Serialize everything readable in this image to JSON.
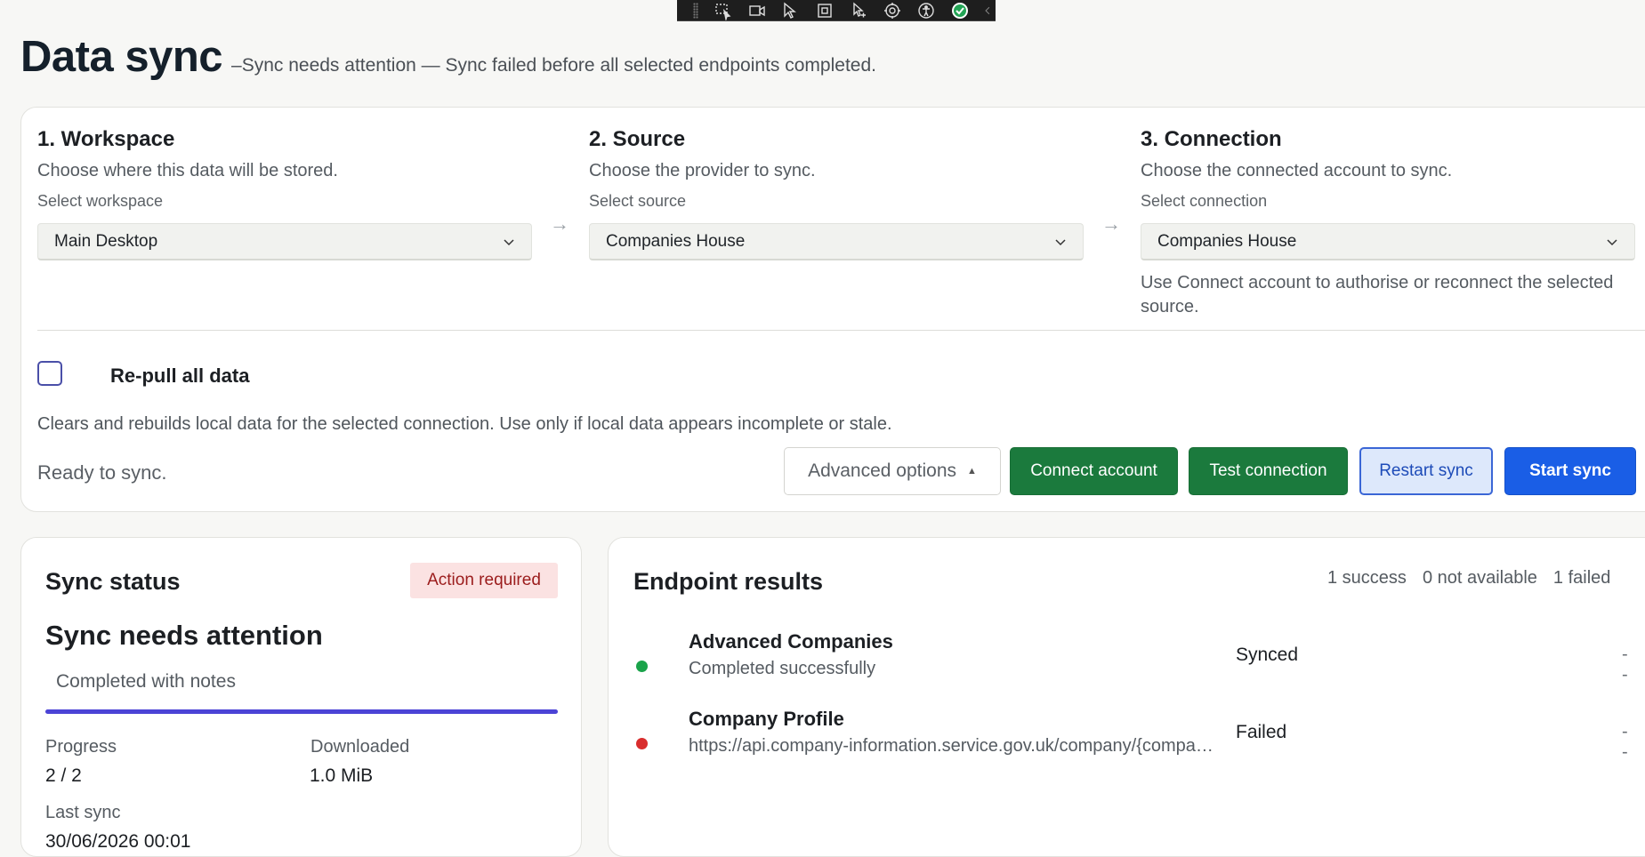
{
  "toolbar": {
    "icons": [
      "select-region-icon",
      "video-icon",
      "cursor-icon",
      "frame-icon",
      "cursor-step-icon",
      "settings-cycle-icon",
      "accessibility-icon",
      "check-circle-icon",
      "collapse-chevron-icon"
    ]
  },
  "header": {
    "title": "Data sync",
    "subtitle": "–Sync needs attention — Sync failed before all selected endpoints completed."
  },
  "steps": {
    "workspace": {
      "title": "1. Workspace",
      "description": "Choose where this data will be stored.",
      "label": "Select workspace",
      "value": "Main Desktop"
    },
    "source": {
      "title": "2. Source",
      "description": "Choose the provider to sync.",
      "label": "Select source",
      "value": "Companies House"
    },
    "connection": {
      "title": "3. Connection",
      "description": "Choose the connected account to sync.",
      "label": "Select connection",
      "value": "Companies House",
      "help": "Use Connect account to authorise or reconnect the selected source."
    },
    "arrow": "→"
  },
  "repull": {
    "label": "Re-pull all data",
    "checked": false,
    "description": "Clears and rebuilds local data for the selected connection. Use only if local data appears incomplete or stale."
  },
  "actions": {
    "ready_text": "Ready to sync.",
    "advanced": "Advanced options",
    "advanced_caret": "▲",
    "connect": "Connect account",
    "test": "Test connection",
    "restart": "Restart sync",
    "start": "Start sync"
  },
  "status": {
    "title": "Sync status",
    "badge": "Action required",
    "headline": "Sync needs attention",
    "note": "Completed with notes",
    "progress_fraction": 1.0,
    "progress_label": "Progress",
    "progress_value": "2 / 2",
    "downloaded_label": "Downloaded",
    "downloaded_value": "1.0 MiB",
    "last_sync_label": "Last sync",
    "last_sync_value": "30/06/2026 00:01"
  },
  "endpoints": {
    "title": "Endpoint results",
    "counts": [
      "1 success",
      "0 not available",
      "1 failed"
    ],
    "rows": [
      {
        "name": "Advanced Companies",
        "detail": "Completed successfully",
        "status": "Synced",
        "dash": "- -",
        "color": "#1aa34a"
      },
      {
        "name": "Company Profile",
        "detail": "https://api.company-information.service.gov.uk/company/{company_number}",
        "status": "Failed",
        "dash": "- -",
        "color": "#d92d2d"
      }
    ]
  },
  "colors": {
    "primary": "#1a5ee6",
    "success": "#1b7a3d",
    "danger": "#d92d2d",
    "progress": "#4b43d6"
  }
}
